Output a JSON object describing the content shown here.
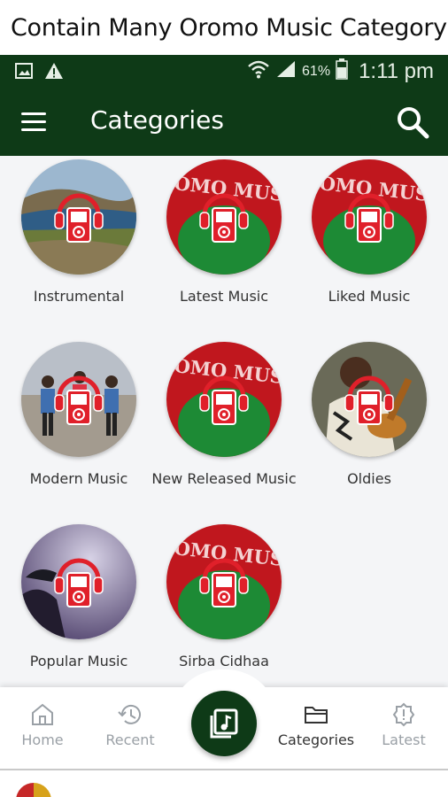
{
  "caption": "Contain Many Oromo Music Category",
  "status_bar": {
    "battery": "61%",
    "time": "1:11 pm"
  },
  "app_bar": {
    "title": "Categories"
  },
  "categories": [
    {
      "label": "Instrumental",
      "thumb": "landscape"
    },
    {
      "label": "Latest Music",
      "thumb": "logo"
    },
    {
      "label": "Liked Music",
      "thumb": "logo"
    },
    {
      "label": "Modern Music",
      "thumb": "dancers"
    },
    {
      "label": "New Released Music",
      "thumb": "logo"
    },
    {
      "label": "Oldies",
      "thumb": "guitarist"
    },
    {
      "label": "Popular Music",
      "thumb": "singer"
    },
    {
      "label": "Sirba Cidhaa",
      "thumb": "logo"
    }
  ],
  "logo_text": "OROMO MUSIC",
  "bottom_nav": {
    "items": [
      {
        "label": "Home"
      },
      {
        "label": "Recent"
      },
      {
        "label": "Categories"
      },
      {
        "label": "Latest"
      }
    ]
  },
  "colors": {
    "brand_green": "#0e3a17",
    "logo_red": "#c0171e",
    "logo_green": "#1d8a35",
    "inactive": "#9aa0a6"
  }
}
